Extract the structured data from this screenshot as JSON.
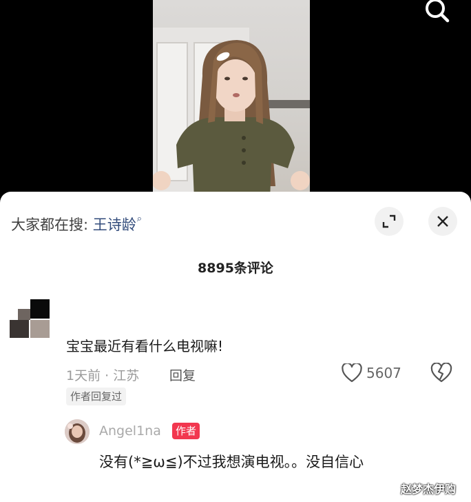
{
  "search_hint": {
    "prefix": "大家都在搜: ",
    "keyword": "王诗龄"
  },
  "comments_header": {
    "count_text": "8895条评论"
  },
  "comment": {
    "text": "宝宝最近有看什么电视嘛!",
    "meta": "1天前 · 江苏",
    "reply_label": "回复",
    "like_count": "5607",
    "author_replied_tag": "作者回复过"
  },
  "reply": {
    "username": "Angel1na",
    "badge": "作者",
    "text": "没有(*≧ω≦)不过我想演电视。。没自信心"
  },
  "watermark": "赵梦杰伊购",
  "colors": {
    "badge": "#f2374f",
    "keyword": "#304a7a",
    "panel": "#ffffff",
    "background": "#000000"
  },
  "icons": [
    "search-icon",
    "expand-icon",
    "close-icon",
    "heart-icon",
    "broken-heart-icon"
  ]
}
